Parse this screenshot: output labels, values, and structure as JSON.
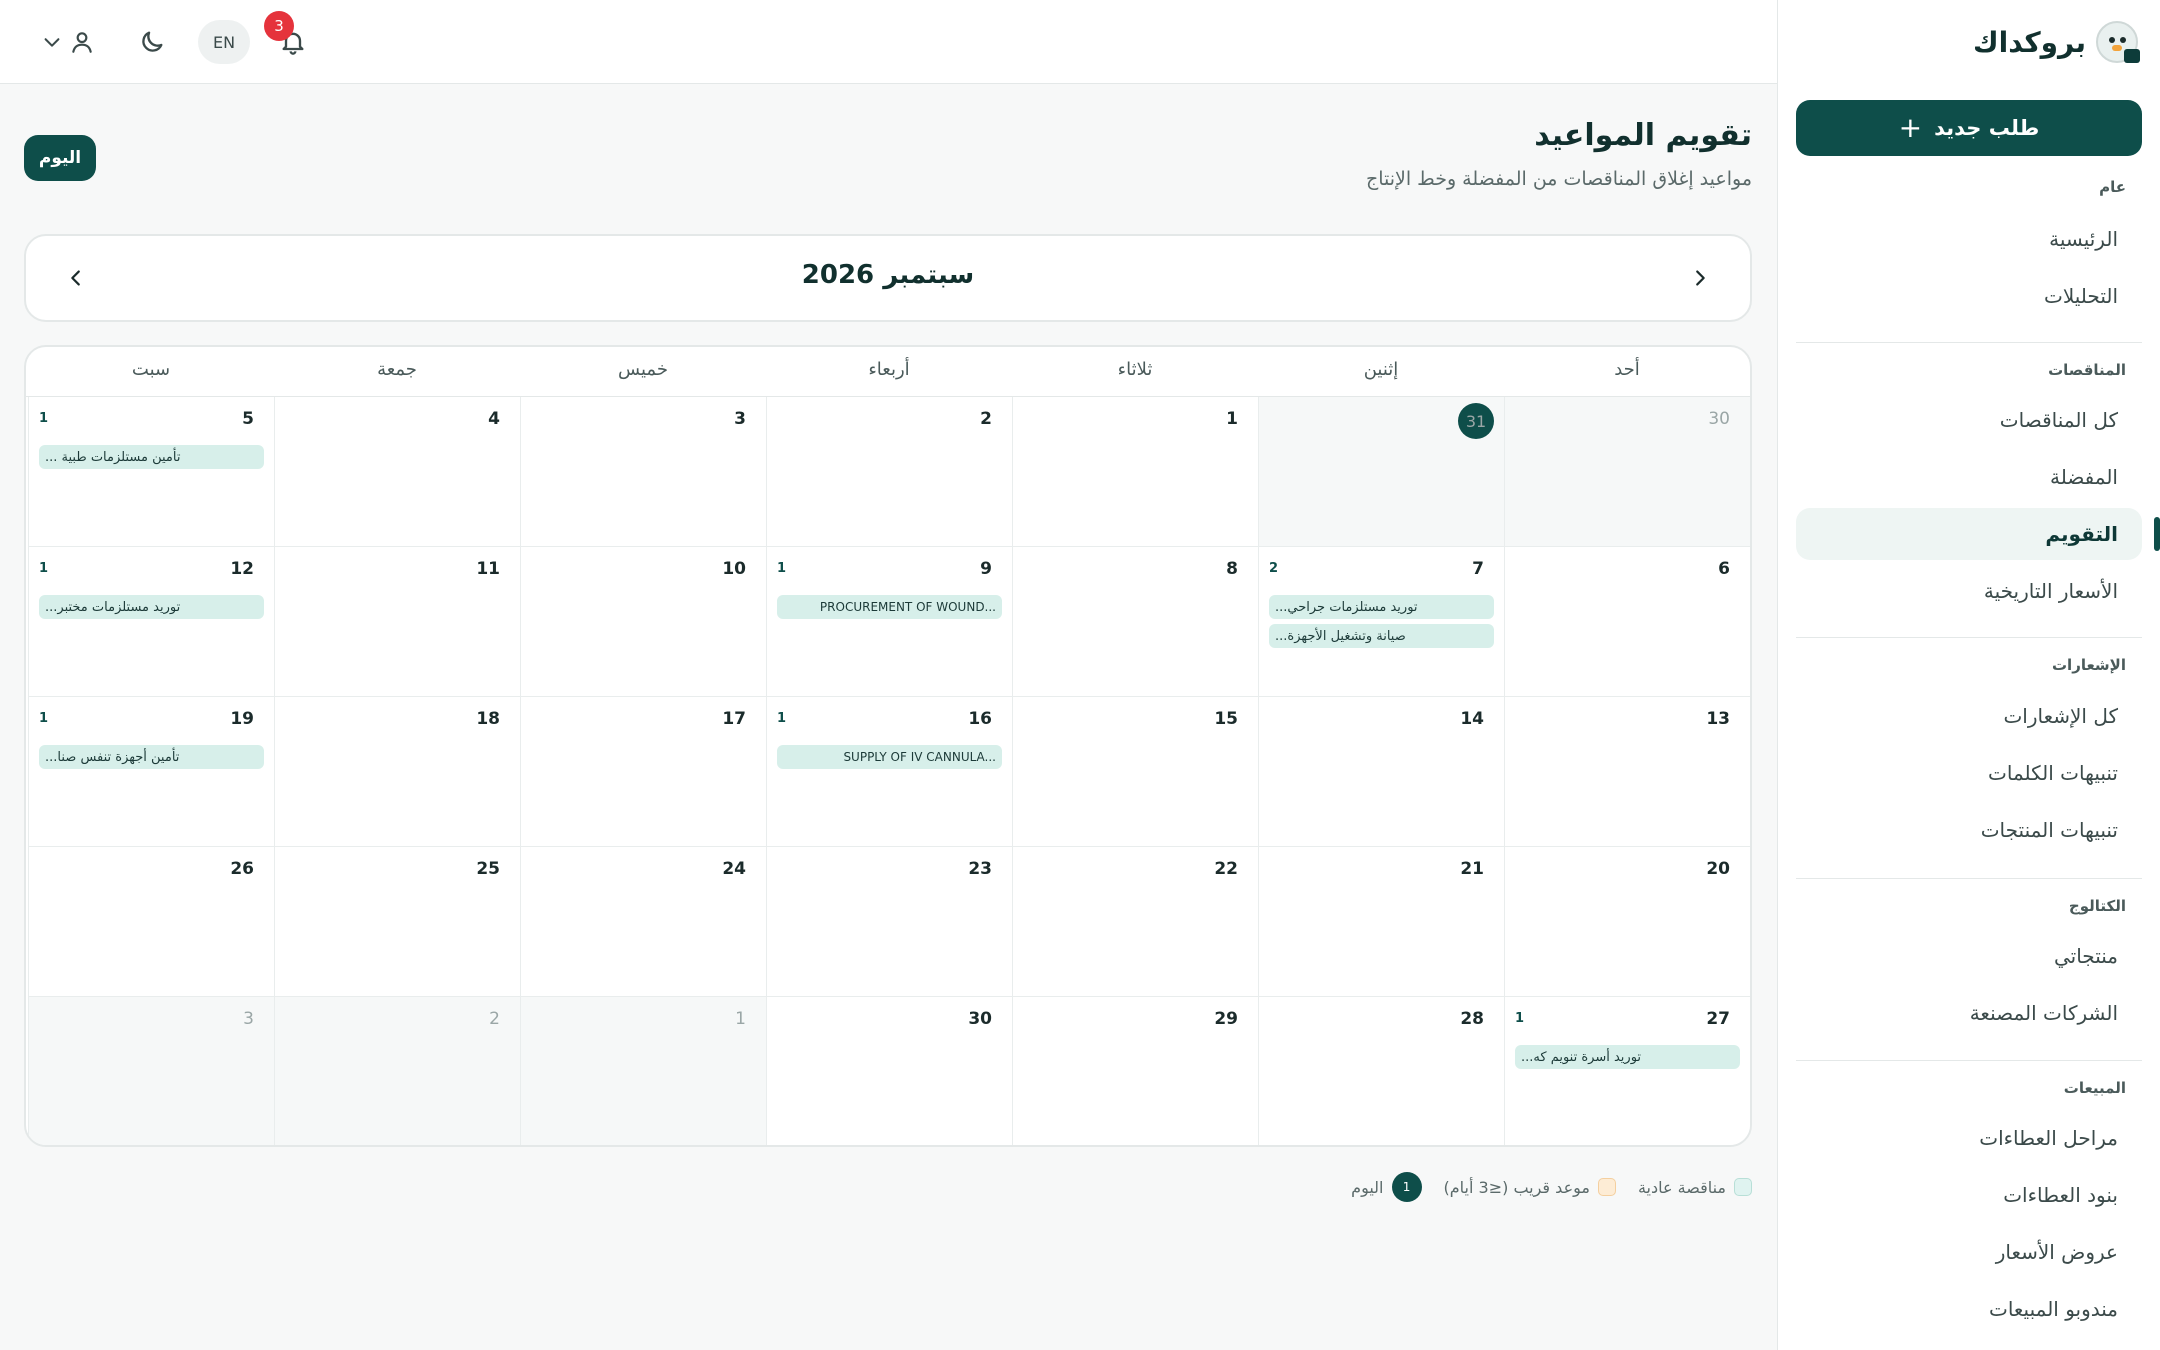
{
  "brand": {
    "name": "بروكداك"
  },
  "sidebar": {
    "new_button": "طلب جديد",
    "groups": [
      {
        "title": "عام",
        "items": [
          "الرئيسية",
          "التحليلات"
        ]
      },
      {
        "title": "المناقصات",
        "items": [
          "كل المناقصات",
          "المفضلة",
          "التقويم",
          "الأسعار التاريخية"
        ]
      },
      {
        "title": "الإشعارات",
        "items": [
          "كل الإشعارات",
          "تنبيهات الكلمات",
          "تنبيهات المنتجات"
        ]
      },
      {
        "title": "الكتالوج",
        "items": [
          "منتجاتي",
          "الشركات المصنعة"
        ]
      },
      {
        "title": "المبيعات",
        "items": [
          "مراحل العطاءات",
          "بنود العطاءات",
          "عروض الأسعار",
          "مندوبو المبيعات"
        ]
      }
    ],
    "active_item": "التقويم"
  },
  "topbar": {
    "lang": "EN",
    "notifications_count": "3"
  },
  "page": {
    "title": "تقويم المواعيد",
    "subtitle": "مواعيد إغلاق المناقصات من المفضلة وخط الإنتاج",
    "today_button": "اليوم",
    "month_label": "سبتمبر 2026"
  },
  "calendar": {
    "days_of_week": [
      "أحد",
      "إثنين",
      "ثلاثاء",
      "أربعاء",
      "خميس",
      "جمعة",
      "سبت"
    ],
    "weeks": [
      [
        {
          "day": "30",
          "out": true
        },
        {
          "day": "31",
          "today": true,
          "out": true
        },
        {
          "day": "1"
        },
        {
          "day": "2"
        },
        {
          "day": "3"
        },
        {
          "day": "4"
        },
        {
          "day": "5",
          "count": "1",
          "events": [
            "تأمين مستلزمات طبية ..."
          ]
        }
      ],
      [
        {
          "day": "6"
        },
        {
          "day": "7",
          "count": "2",
          "events": [
            "توريد مستلزمات جراحي...",
            "صيانة وتشغيل الأجهزة..."
          ]
        },
        {
          "day": "8"
        },
        {
          "day": "9",
          "count": "1",
          "events": [
            "PROCUREMENT OF WOUND..."
          ],
          "ltr": true
        },
        {
          "day": "10"
        },
        {
          "day": "11"
        },
        {
          "day": "12",
          "count": "1",
          "events": [
            "توريد مستلزمات مختبر..."
          ]
        }
      ],
      [
        {
          "day": "13"
        },
        {
          "day": "14"
        },
        {
          "day": "15"
        },
        {
          "day": "16",
          "count": "1",
          "events": [
            "SUPPLY OF IV CANNULA..."
          ],
          "ltr": true
        },
        {
          "day": "17"
        },
        {
          "day": "18"
        },
        {
          "day": "19",
          "count": "1",
          "events": [
            "تأمين أجهزة تنفس صنا..."
          ]
        }
      ],
      [
        {
          "day": "20"
        },
        {
          "day": "21"
        },
        {
          "day": "22"
        },
        {
          "day": "23"
        },
        {
          "day": "24"
        },
        {
          "day": "25"
        },
        {
          "day": "26"
        }
      ],
      [
        {
          "day": "27",
          "count": "1",
          "events": [
            "توريد أسرة تنويم كه..."
          ]
        },
        {
          "day": "28"
        },
        {
          "day": "29"
        },
        {
          "day": "30"
        },
        {
          "day": "1",
          "out": true
        },
        {
          "day": "2",
          "out": true
        },
        {
          "day": "3",
          "out": true
        }
      ]
    ]
  },
  "legend": {
    "normal": "مناقصة عادية",
    "near": "موعد قريب (≤3 أيام)",
    "today": "اليوم",
    "today_marker": "1"
  }
}
